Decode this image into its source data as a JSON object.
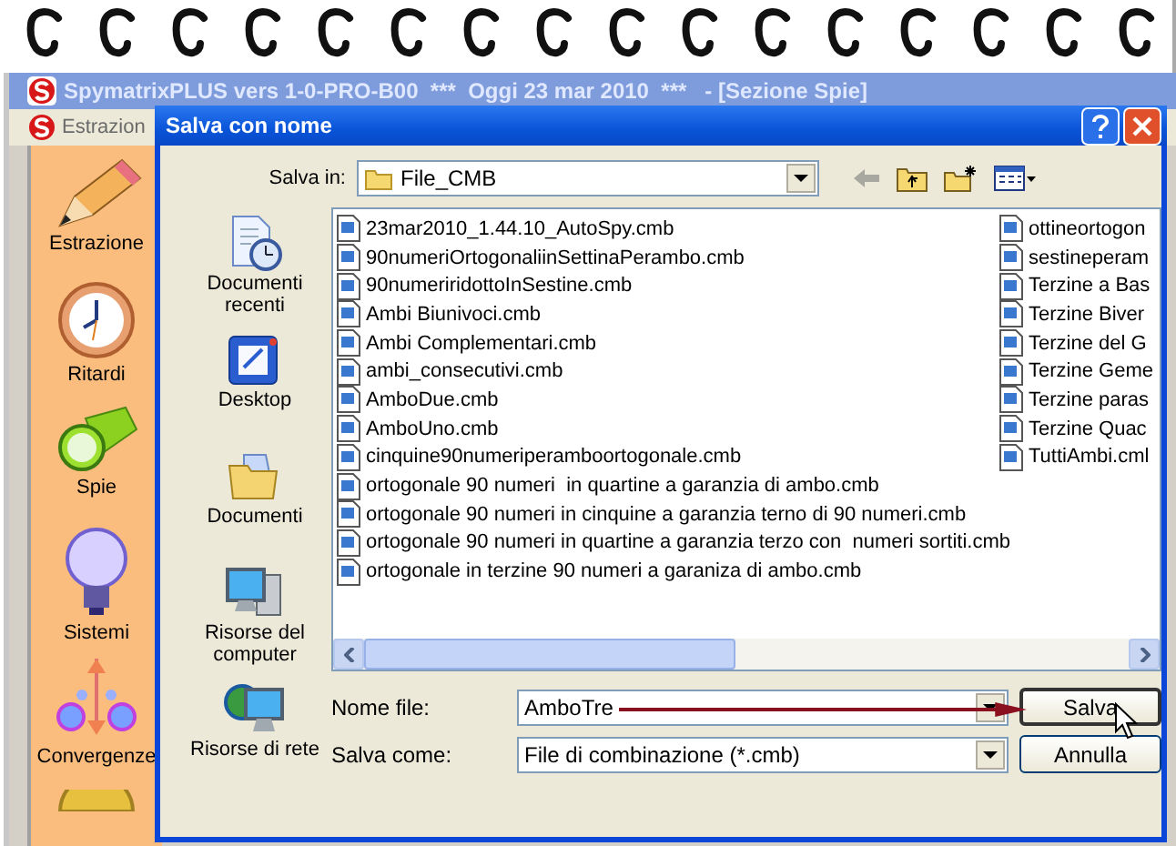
{
  "app": {
    "title": "SpymatrixPLUS vers 1-0-PRO-B00  ***  Oggi 23 mar 2010  ***   - [Sezione Spie]",
    "menu": [
      "Estrazion"
    ],
    "sidebar": [
      {
        "label": "Estrazione"
      },
      {
        "label": "Ritardi"
      },
      {
        "label": "Spie"
      },
      {
        "label": "Sistemi"
      },
      {
        "label": "Convergenze"
      }
    ]
  },
  "dialog": {
    "title": "Salva con nome",
    "save_in": {
      "label": "Salva in:",
      "value": "File_CMB"
    },
    "places": [
      {
        "label": "Documenti recenti"
      },
      {
        "label": "Desktop"
      },
      {
        "label": "Documenti"
      },
      {
        "label": "Risorse del computer"
      },
      {
        "label": "Risorse di rete"
      }
    ],
    "files": [
      [
        "23mar2010_1.44.10_AutoSpy.cmb",
        "90numeriOrtogonaliinSettinaPerambo.cmb",
        "90numeriridottoInSestine.cmb",
        "Ambi Biunivoci.cmb",
        "Ambi Complementari.cmb",
        "ambi_consecutivi.cmb",
        "AmboDue.cmb",
        "AmboUno.cmb",
        "cinquine90numeriperamboortogonale.cmb",
        "ortogonale 90 numeri  in quartine a garanzia di ambo.cmb",
        "ortogonale 90 numeri in cinquine a garanzia terno di 90 numeri.cmb",
        "ortogonale 90 numeri in quartine a garanzia terzo con  numeri sortiti.cmb",
        "ortogonale in terzine 90 numeri a garaniza di ambo.cmb"
      ],
      [
        "ottineortogon",
        "sestineperam",
        "Terzine a Bas",
        "Terzine Biver",
        "Terzine del G",
        "Terzine Geme",
        "Terzine paras",
        "Terzine Quac",
        "TuttiAmbi.cml"
      ]
    ],
    "file_name": {
      "label": "Nome file:",
      "value": "AmboTre"
    },
    "save_as": {
      "label": "Salva come:",
      "value": "File di combinazione (*.cmb)"
    },
    "buttons": [
      "Salva",
      "Annulla"
    ]
  }
}
